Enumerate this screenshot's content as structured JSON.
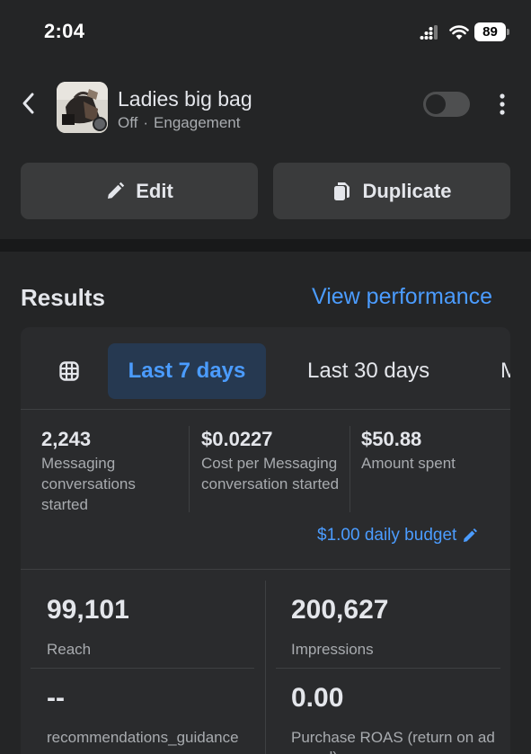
{
  "status_bar": {
    "time": "2:04",
    "battery": "89"
  },
  "header": {
    "ad_title": "Ladies big bag",
    "status": "Off",
    "separator": "·",
    "objective": "Engagement"
  },
  "actions": {
    "edit_label": "Edit",
    "duplicate_label": "Duplicate"
  },
  "results": {
    "title": "Results",
    "view_performance": "View performance",
    "tabs": [
      {
        "label": "Last 7 days",
        "active": true
      },
      {
        "label": "Last 30 days",
        "active": false
      },
      {
        "label": "M",
        "active": false
      }
    ],
    "metrics": [
      {
        "value": "2,243",
        "label": "Messaging conversations started"
      },
      {
        "value": "$0.0227",
        "label": "Cost per Messaging conversation started"
      },
      {
        "value": "$50.88",
        "label": "Amount spent"
      }
    ],
    "budget": "$1.00 daily budget",
    "stats": [
      {
        "value": "99,101",
        "label": "Reach"
      },
      {
        "value": "200,627",
        "label": "Impressions"
      },
      {
        "value": "--",
        "label": "recommendations_guidance"
      },
      {
        "value": "0.00",
        "label": "Purchase ROAS (return on ad spend)"
      }
    ]
  },
  "colors": {
    "accent": "#4b9cff",
    "background": "#242526",
    "card": "#2a2b2d",
    "button": "#3a3b3c"
  }
}
